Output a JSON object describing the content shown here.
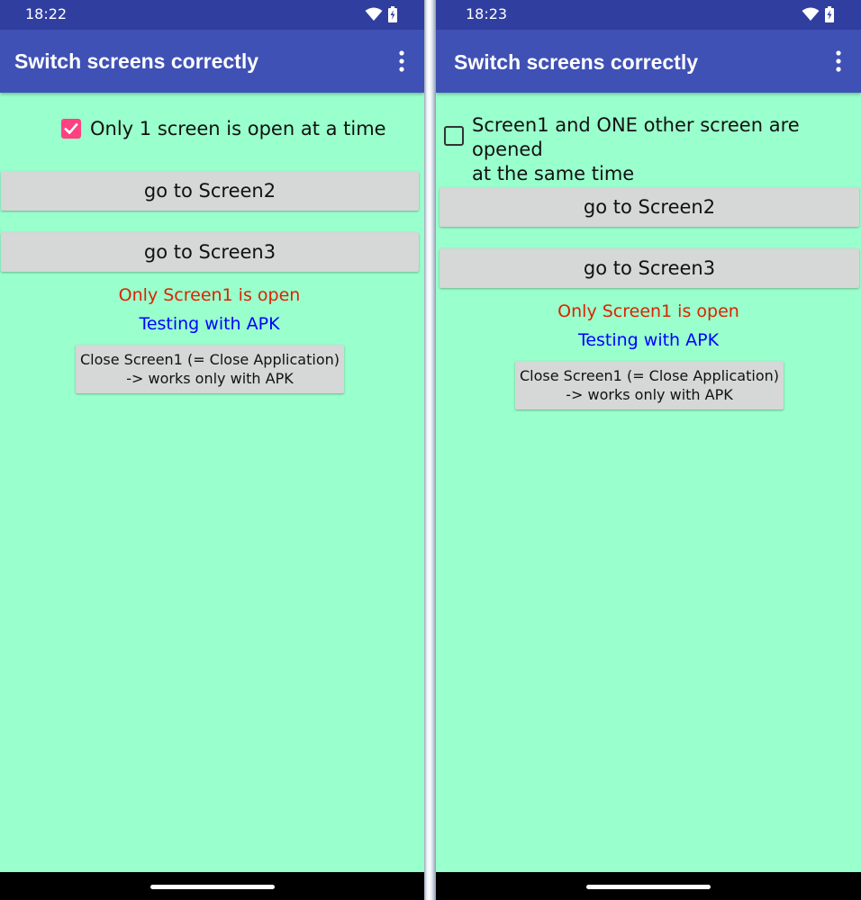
{
  "app": {
    "title": "Switch screens correctly"
  },
  "colors": {
    "statusbar": "#303f9f",
    "appbar": "#3f51b5",
    "background": "#99ffcc",
    "checkbox_accent": "#ff4081",
    "status_text_red": "#dd2200",
    "apk_text_blue": "#0000ff",
    "button_gray": "#d6d7d7"
  },
  "left_screen": {
    "status_time": "18:22",
    "checkbox": {
      "checked": true,
      "label": "Only 1 screen is open at a time"
    },
    "go_screen2_label": "go to Screen2",
    "go_screen3_label": "go to Screen3",
    "status_message": "Only Screen1 is open",
    "apk_message": "Testing with APK",
    "close_button": {
      "line1": "Close Screen1 (= Close Application)",
      "line2": "-> works only with APK"
    }
  },
  "right_screen": {
    "status_time": "18:23",
    "checkbox": {
      "checked": false,
      "label_line1": "Screen1 and ONE other screen are opened",
      "label_line2": "at the same time"
    },
    "go_screen2_label": "go to Screen2",
    "go_screen3_label": "go to Screen3",
    "status_message": "Only Screen1 is open",
    "apk_message": "Testing with APK",
    "close_button": {
      "line1": "Close Screen1 (= Close Application)",
      "line2": "-> works only with APK"
    }
  },
  "icons": {
    "wifi": "wifi-icon",
    "battery": "battery-charging-icon",
    "overflow": "more-vert-icon",
    "checkmark": "check-icon"
  }
}
